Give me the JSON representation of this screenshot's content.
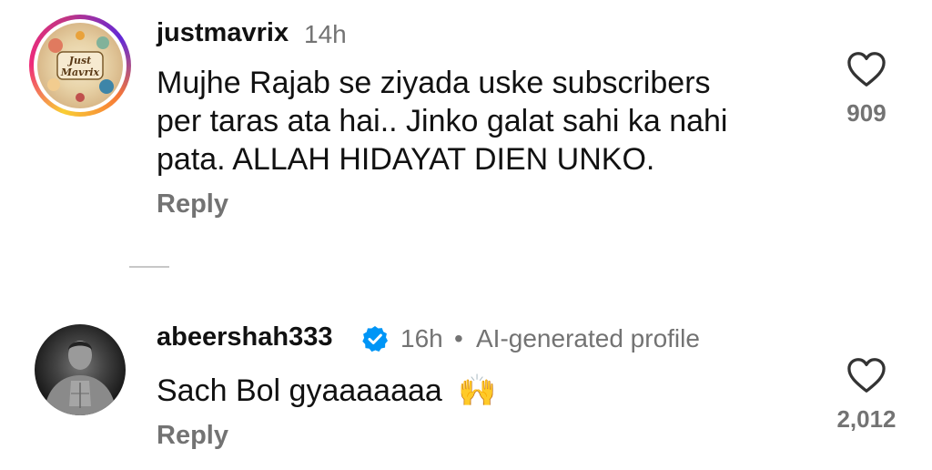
{
  "comments": [
    {
      "username": "justmavrix",
      "time": "14h",
      "avatar_text": "Just Mavrix",
      "lines": [
        "Mujhe Rajab se ziyada uske subscribers",
        "per taras ata hai.. Jinko galat sahi ka nahi",
        "pata. ALLAH HIDAYAT DIEN UNKO."
      ],
      "reply_label": "Reply",
      "like_count": "909",
      "like_icon": "heart-outline-icon"
    },
    {
      "username": "abeershah333",
      "verified_icon": "verified-badge-icon",
      "time": "16h",
      "separator": "•",
      "profile_note": "AI-generated profile",
      "text": "Sach Bol gyaaaaaaa",
      "emoji": "🙌",
      "reply_label": "Reply",
      "like_count": "2,012",
      "like_icon": "heart-outline-icon"
    }
  ],
  "colors": {
    "verified": "#0095f6",
    "secondary_text": "#737373",
    "primary_text": "#111111"
  }
}
